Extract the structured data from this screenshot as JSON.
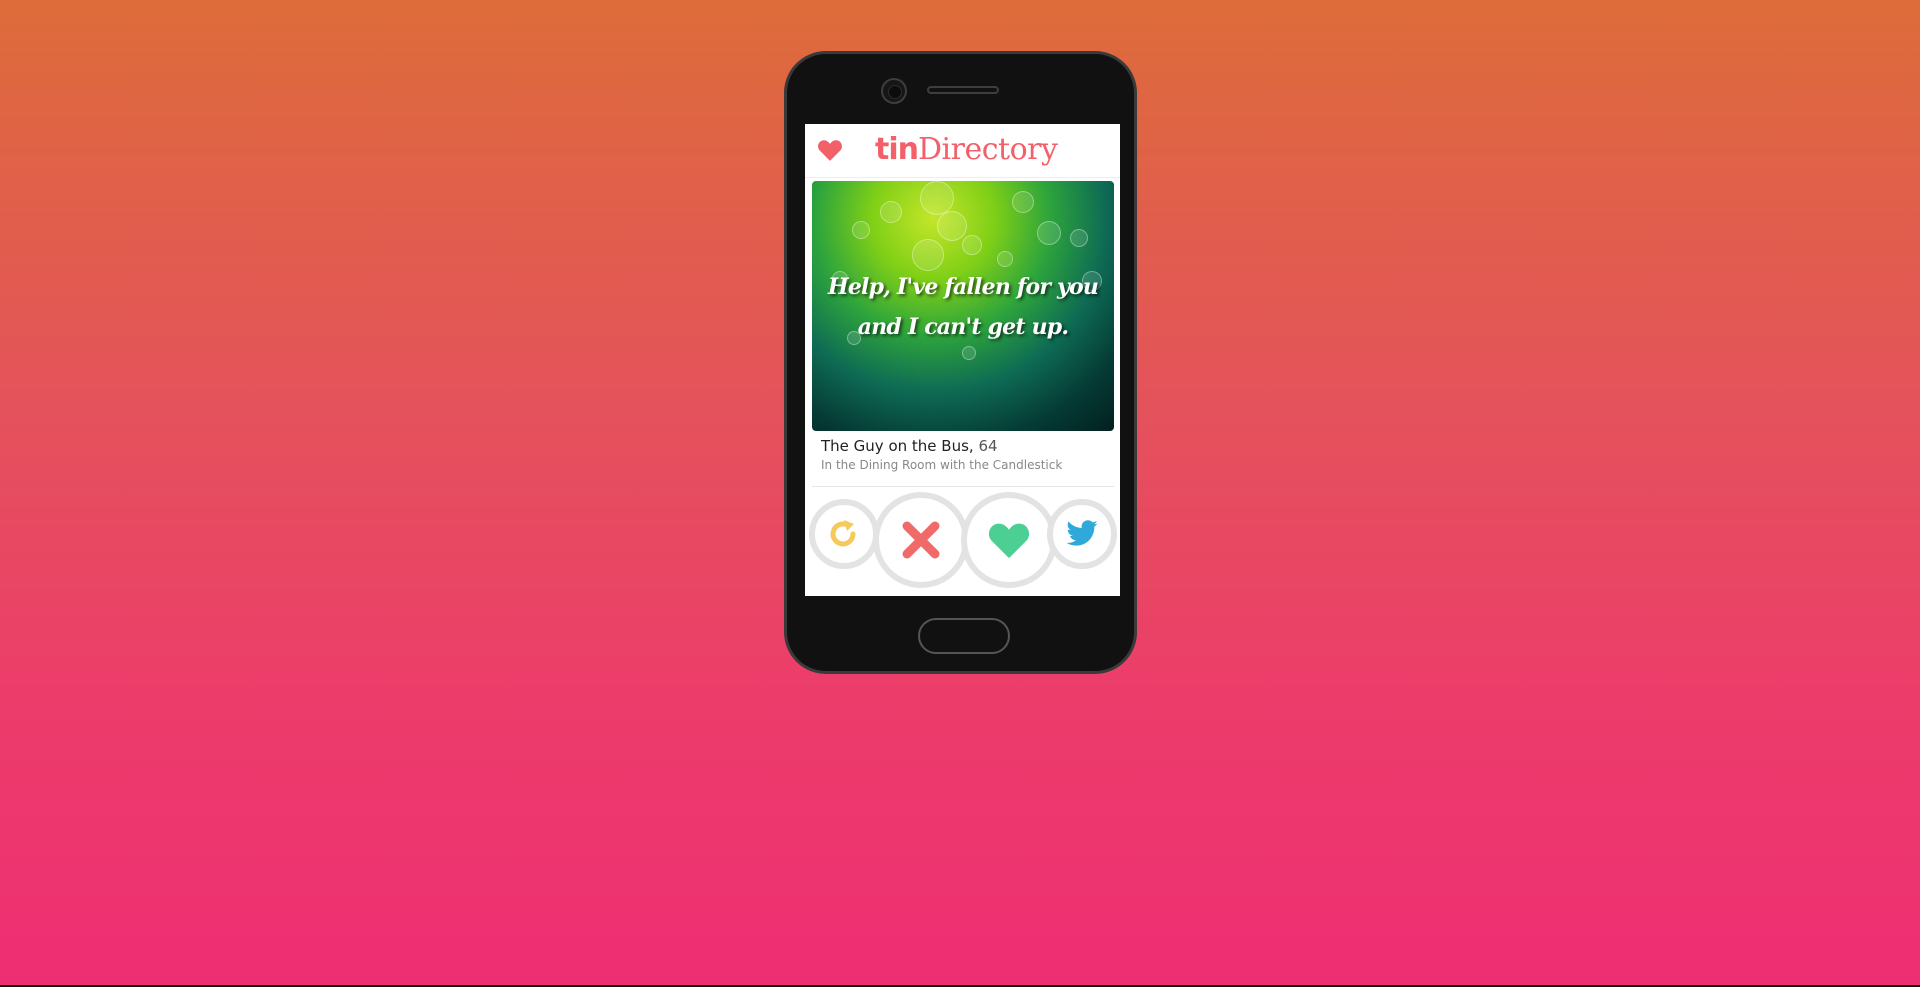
{
  "app": {
    "title_bold": "tin",
    "title_rest": "Directory"
  },
  "profile": {
    "quote": "Help, I've fallen for you and I can't get up.",
    "name": "The Guy on the Bus",
    "age": "64",
    "location": "In the Dining Room with the Candlestick"
  },
  "colors": {
    "brand": "#f2606a",
    "rewind": "#f5c95a",
    "nope": "#f06a6a",
    "like": "#4ccf92",
    "share": "#2ea9d9",
    "ring": "#e3e3e3"
  },
  "icons": {
    "header": "heart-icon",
    "rewind": "rewind-icon",
    "nope": "x-icon",
    "like": "heart-icon",
    "share": "twitter-icon"
  }
}
